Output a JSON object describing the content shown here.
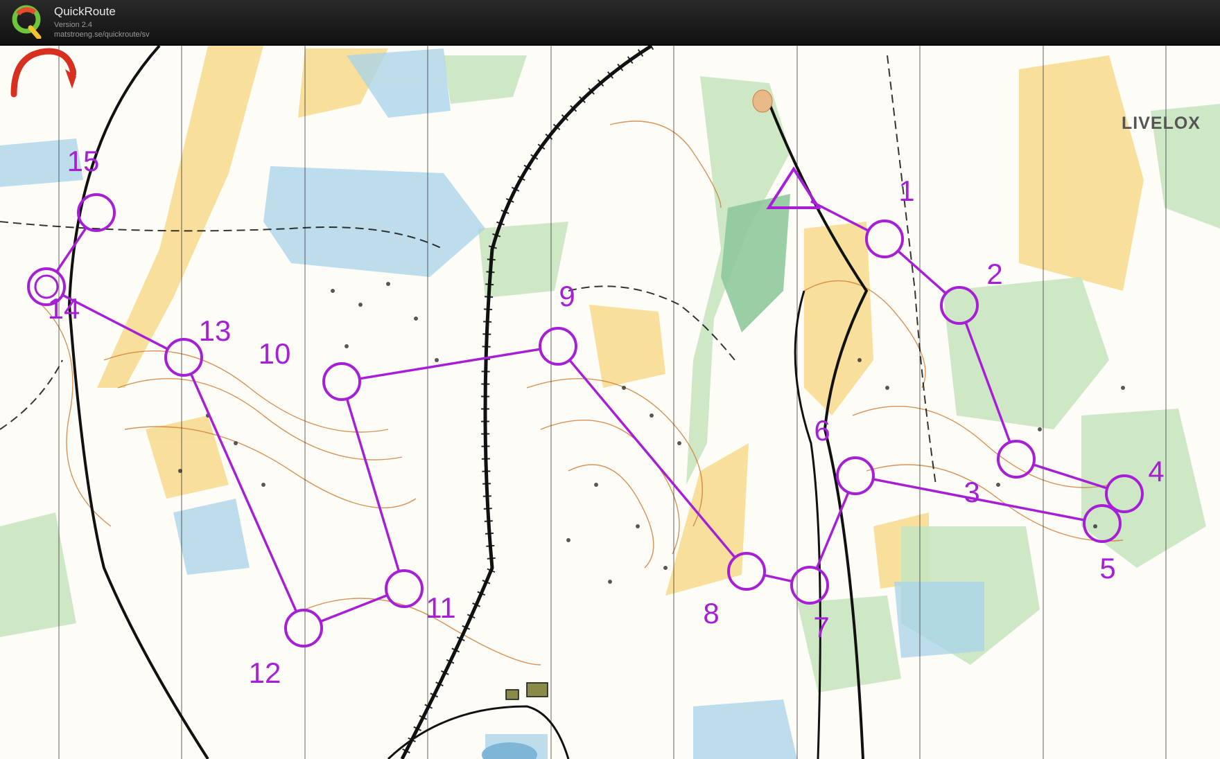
{
  "app": {
    "name": "QuickRoute",
    "version": "Version 2.4",
    "url": "matstroeng.se/quickroute/sv"
  },
  "watermark": {
    "text": "LIVELOX"
  },
  "course": {
    "color": "#a61fd6",
    "start": {
      "name": "start"
    },
    "controls": [
      {
        "label": "1"
      },
      {
        "label": "2"
      },
      {
        "label": "3"
      },
      {
        "label": "4"
      },
      {
        "label": "5"
      },
      {
        "label": "6"
      },
      {
        "label": "7"
      },
      {
        "label": "8"
      },
      {
        "label": "9"
      },
      {
        "label": "10"
      },
      {
        "label": "11"
      },
      {
        "label": "12"
      },
      {
        "label": "13"
      },
      {
        "label": "14"
      },
      {
        "label": "15"
      }
    ]
  },
  "colors": {
    "forest_green": "#c9e6c0",
    "dark_green": "#8fc99a",
    "open_yellow": "#f7d98b",
    "marsh_blue": "#2a8fbf",
    "contour_brown": "#d0782c",
    "road_black": "#111111"
  }
}
